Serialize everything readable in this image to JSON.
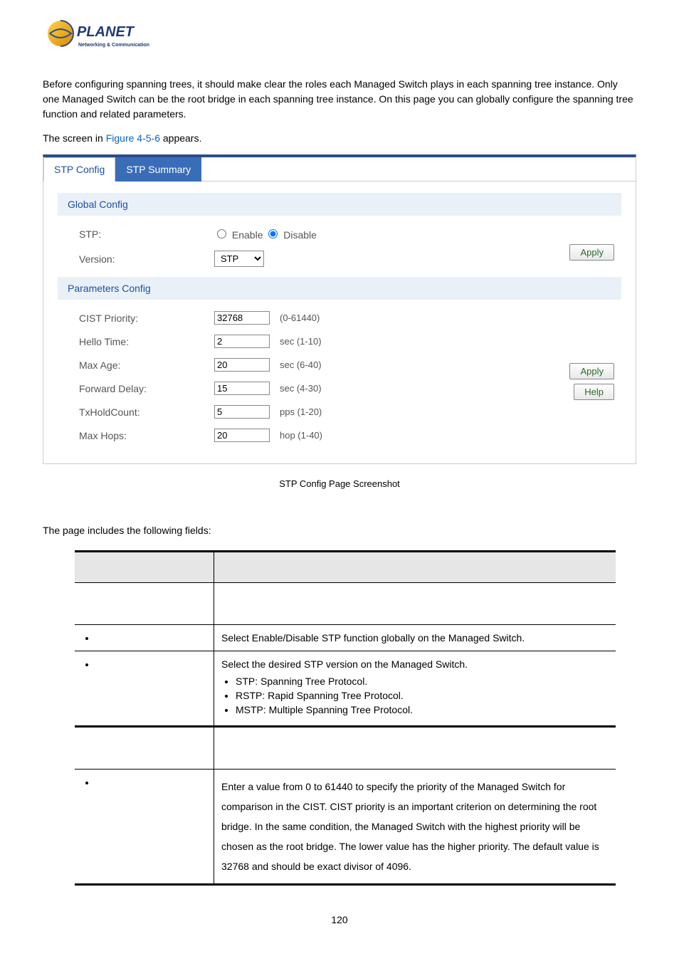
{
  "logo": {
    "brand": "PLANET",
    "tagline": "Networking & Communication"
  },
  "intro": "Before configuring spanning trees, it should make clear the roles each Managed Switch plays in each spanning tree instance. Only one Managed Switch can be the root bridge in each spanning tree instance. On this page you can globally configure the spanning tree function and related parameters.",
  "figure_prefix": "The screen in ",
  "figure_link": "Figure 4-5-6",
  "figure_suffix": " appears.",
  "tabs": {
    "active": "STP Config",
    "inactive": "STP Summary"
  },
  "global_section": {
    "title": "Global Config",
    "stp_label": "STP:",
    "enable_label": "Enable",
    "disable_label": "Disable",
    "stp_checked": "disable",
    "version_label": "Version:",
    "version_value": "STP",
    "apply": "Apply"
  },
  "params_section": {
    "title": "Parameters Config",
    "rows": [
      {
        "label": "CIST Priority:",
        "value": "32768",
        "hint": "(0-61440)"
      },
      {
        "label": "Hello Time:",
        "value": "2",
        "hint": "sec (1-10)"
      },
      {
        "label": "Max Age:",
        "value": "20",
        "hint": "sec (6-40)"
      },
      {
        "label": "Forward Delay:",
        "value": "15",
        "hint": "sec (4-30)"
      },
      {
        "label": "TxHoldCount:",
        "value": "5",
        "hint": "pps (1-20)"
      },
      {
        "label": "Max Hops:",
        "value": "20",
        "hint": "hop (1-40)"
      }
    ],
    "apply": "Apply",
    "help": "Help"
  },
  "caption": "STP Config Page Screenshot",
  "fields_intro": "The page includes the following fields:",
  "table": {
    "row_stp": "Select Enable/Disable STP function globally on the Managed Switch.",
    "row_version_lead": "Select the desired STP version on the Managed Switch.",
    "row_version_items": [
      "STP: Spanning Tree Protocol.",
      "RSTP: Rapid Spanning Tree Protocol.",
      "MSTP: Multiple Spanning Tree Protocol."
    ],
    "row_cist": "Enter a value from 0 to 61440 to specify the priority of the Managed Switch for comparison in the CIST. CIST priority is an important criterion on determining the root bridge. In the same condition, the Managed Switch with the highest priority will be chosen as the root bridge. The lower value has the higher priority. The default value is 32768 and should be exact divisor of 4096."
  },
  "page_number": "120"
}
